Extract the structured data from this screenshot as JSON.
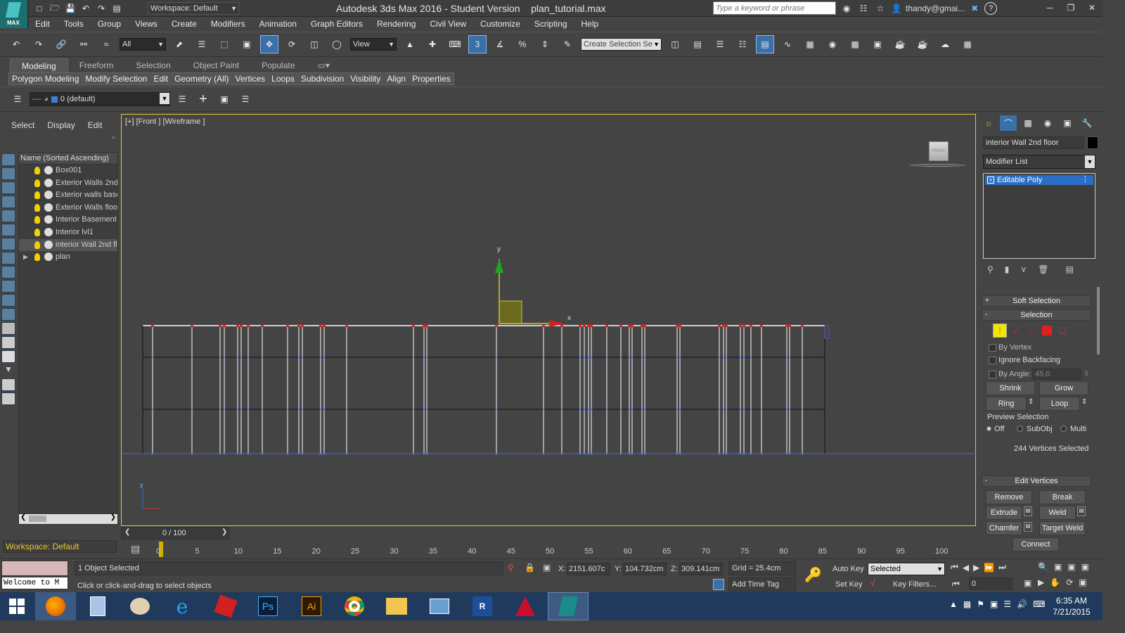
{
  "titlebar": {
    "app_logo": "MAX",
    "workspace": "Workspace: Default",
    "title": "Autodesk 3ds Max 2016 - Student Version",
    "filename": "plan_tutorial.max",
    "search_placeholder": "Type a keyword or phrase",
    "user": "thandy@gmai...",
    "help": "?"
  },
  "menu": [
    "Edit",
    "Tools",
    "Group",
    "Views",
    "Create",
    "Modifiers",
    "Animation",
    "Graph Editors",
    "Rendering",
    "Civil View",
    "Customize",
    "Scripting",
    "Help"
  ],
  "toolbar": {
    "filter": "All",
    "ref_coord": "View",
    "snap_label": "3",
    "angle_snap": "%",
    "named_selection": "Create Selection Se"
  },
  "ribbon": {
    "tabs": [
      "Modeling",
      "Freeform",
      "Selection",
      "Object Paint",
      "Populate"
    ],
    "items": [
      "Polygon Modeling",
      "Modify Selection",
      "Edit",
      "Geometry (All)",
      "Vertices",
      "Loops",
      "Subdivision",
      "Visibility",
      "Align",
      "Properties"
    ]
  },
  "layer": {
    "name": "0 (default)"
  },
  "scene_explorer": {
    "tabs": [
      "Select",
      "Display",
      "Edit"
    ],
    "header": "Name (Sorted Ascending)",
    "items": [
      "Box001",
      "Exterior Walls 2nd",
      "Exterior walls base",
      "Exterior Walls floo",
      "Interior Basement",
      "Interior lvl1",
      "interior Wall 2nd fl",
      "plan"
    ],
    "workspace": "Workspace: Default"
  },
  "viewport": {
    "label": "[+] [Front ] [Wireframe ]",
    "viewcube": "FRONT",
    "axis_y": "y",
    "axis_x": "x",
    "gizmo_z": "z"
  },
  "time_slider": {
    "position": "0 / 100",
    "ticks": [
      "0",
      "5",
      "10",
      "15",
      "20",
      "25",
      "30",
      "35",
      "40",
      "45",
      "50",
      "55",
      "60",
      "65",
      "70",
      "75",
      "80",
      "85",
      "90",
      "95",
      "100"
    ]
  },
  "command_panel": {
    "object_name": "interior Wall 2nd floor",
    "modifier_list": "Modifier List",
    "stack_item": "Editable Poly",
    "soft_selection": "Soft Selection",
    "selection": "Selection",
    "by_vertex": "By Vertex",
    "ignore_backfacing": "Ignore Backfacing",
    "by_angle": "By Angle:",
    "angle_value": "45.0",
    "shrink": "Shrink",
    "grow": "Grow",
    "ring": "Ring",
    "loop": "Loop",
    "preview_selection": "Preview Selection",
    "preview_off": "Off",
    "preview_subobj": "SubObj",
    "preview_multi": "Multi",
    "vertices_selected": "244 Vertices Selected",
    "edit_vertices": "Edit Vertices",
    "remove": "Remove",
    "break": "Break",
    "extrude": "Extrude",
    "weld": "Weld",
    "chamfer": "Chamfer",
    "target_weld": "Target Weld",
    "connect": "Connect"
  },
  "status": {
    "objects_selected": "1 Object Selected",
    "prompt": "Click or click-and-drag to select objects",
    "welcome": "Welcome to M",
    "x_label": "X:",
    "x": "2151.607c",
    "y_label": "Y:",
    "y": "104.732cm",
    "z_label": "Z:",
    "z": "309.141cm",
    "grid": "Grid = 25.4cm",
    "add_time_tag": "Add Time Tag",
    "auto_key": "Auto Key",
    "set_key": "Set Key",
    "key_mode": "Selected",
    "key_filters": "Key Filters...",
    "frame": "0"
  },
  "taskbar": {
    "time": "6:35 AM",
    "date": "7/21/2015",
    "apps": [
      "firefox",
      "calculator",
      "paint",
      "ie",
      "sketchup",
      "Ps",
      "Ai",
      "chrome",
      "explorer",
      "remote",
      "revit",
      "autocad",
      "3dsmax"
    ]
  }
}
